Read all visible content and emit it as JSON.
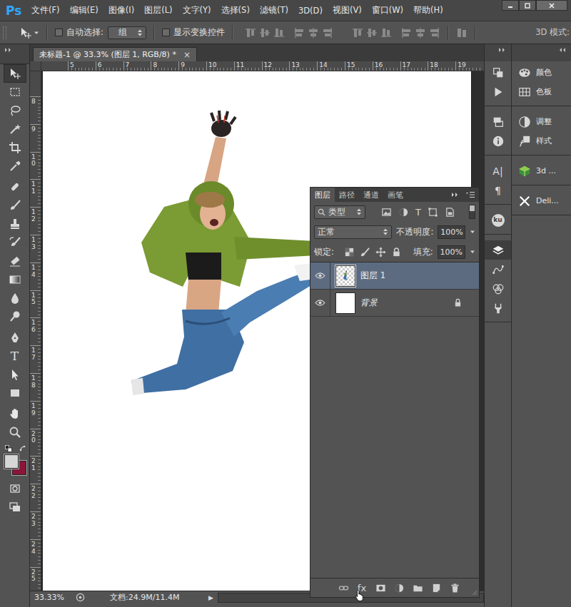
{
  "app": {
    "logo": "Ps"
  },
  "menu": [
    "文件(F)",
    "编辑(E)",
    "图像(I)",
    "图层(L)",
    "文字(Y)",
    "选择(S)",
    "滤镜(T)",
    "3D(D)",
    "视图(V)",
    "窗口(W)",
    "帮助(H)"
  ],
  "options_bar": {
    "auto_select": {
      "label": "自动选择:",
      "checked": false
    },
    "auto_select_target": "组",
    "show_transform": {
      "label": "显示变换控件",
      "checked": false
    },
    "mode_label": "3D 模式:"
  },
  "tools": [
    [
      {
        "kind": "move",
        "selected": true
      },
      {
        "kind": "marquee",
        "selected": false
      },
      {
        "kind": "lasso",
        "selected": false
      },
      {
        "kind": "wand",
        "selected": false
      },
      {
        "kind": "crop",
        "selected": false
      },
      {
        "kind": "eyedropper",
        "selected": false
      }
    ],
    [
      {
        "kind": "heal",
        "selected": false
      },
      {
        "kind": "brush",
        "selected": false
      },
      {
        "kind": "stamp",
        "selected": false
      },
      {
        "kind": "history",
        "selected": false
      },
      {
        "kind": "eraser",
        "selected": false
      },
      {
        "kind": "gradient",
        "selected": false
      },
      {
        "kind": "blur",
        "selected": false
      },
      {
        "kind": "dodge",
        "selected": false
      }
    ],
    [
      {
        "kind": "pen",
        "selected": false
      },
      {
        "kind": "type",
        "glyph": "T",
        "selected": false
      },
      {
        "kind": "path-select",
        "selected": false
      },
      {
        "kind": "shape",
        "selected": false
      }
    ],
    [
      {
        "kind": "hand",
        "selected": false
      },
      {
        "kind": "zoom",
        "selected": false
      }
    ]
  ],
  "swatches": {
    "foreground": "#d6d6d6",
    "background": "#8a1538"
  },
  "document": {
    "tab": {
      "title": "未标题-1 @ 33.3% (图层 1, RGB/8) *",
      "close": "×",
      "selected": true
    },
    "ruler_h": [
      "5",
      "6",
      "7",
      "8",
      "9",
      "10",
      "11",
      "12",
      "13",
      "14",
      "15",
      "16",
      "17",
      "18",
      "19"
    ],
    "ruler_v": [
      "8",
      "9",
      "10",
      "11",
      "12",
      "13",
      "14",
      "15",
      "16",
      "17",
      "18",
      "19",
      "20",
      "21",
      "22",
      "23",
      "24",
      "25"
    ],
    "status": {
      "zoom": "33.33%",
      "info": "文档:24.9M/11.4M",
      "arrow": "▶"
    }
  },
  "layers_panel": {
    "tabs": [
      {
        "label": "图层",
        "selected": true
      },
      {
        "label": "路径",
        "selected": false
      },
      {
        "label": "通道",
        "selected": false
      },
      {
        "label": "画笔",
        "selected": false
      }
    ],
    "filter": "类型",
    "filter_icons": [
      {
        "kind": "pixel"
      },
      {
        "kind": "adjust"
      },
      {
        "kind": "type",
        "glyph": "T"
      },
      {
        "kind": "shape"
      },
      {
        "kind": "smart"
      }
    ],
    "filter_enabled": false,
    "blend_mode": "正常",
    "opacity_label": "不透明度:",
    "opacity": "100%",
    "lock_label": "锁定:",
    "fill_label": "填充:",
    "fill": "100%",
    "layers": [
      {
        "name": "图层 1",
        "kind": "image",
        "selected": true,
        "visible": true,
        "locked": false
      },
      {
        "name": "背景",
        "kind": "background",
        "selected": false,
        "visible": true,
        "locked": true
      }
    ],
    "bottom_icons": [
      {
        "kind": "link"
      },
      {
        "kind": "fx",
        "glyph": "fx"
      },
      {
        "kind": "mask"
      },
      {
        "kind": "adjust"
      },
      {
        "kind": "group"
      },
      {
        "kind": "new"
      },
      {
        "kind": "delete"
      }
    ]
  },
  "dock": [
    [
      {
        "kind": "history",
        "selected": false
      },
      {
        "kind": "actions",
        "selected": false
      }
    ],
    [
      {
        "kind": "comps",
        "selected": false
      },
      {
        "kind": "info",
        "selected": false
      }
    ],
    [
      {
        "kind": "character",
        "glyph": "A|",
        "selected": false
      },
      {
        "kind": "paragraph",
        "glyph": "¶",
        "selected": false
      }
    ],
    [
      {
        "kind": "plugin",
        "glyph": "ku",
        "selected": false
      }
    ],
    [
      {
        "kind": "layers",
        "selected": true
      },
      {
        "kind": "paths",
        "selected": false
      },
      {
        "kind": "channels",
        "selected": false
      },
      {
        "kind": "presets",
        "selected": false
      }
    ]
  ],
  "panels": [
    [
      {
        "label": "颜色",
        "kind": "color"
      },
      {
        "label": "色板",
        "kind": "swatches"
      }
    ],
    [
      {
        "label": "调整",
        "kind": "adjust"
      },
      {
        "label": "样式",
        "kind": "styles"
      }
    ],
    [
      {
        "label": "3d ...",
        "kind": "3d"
      }
    ],
    [
      {
        "label": "Deli...",
        "kind": "deli"
      }
    ]
  ]
}
